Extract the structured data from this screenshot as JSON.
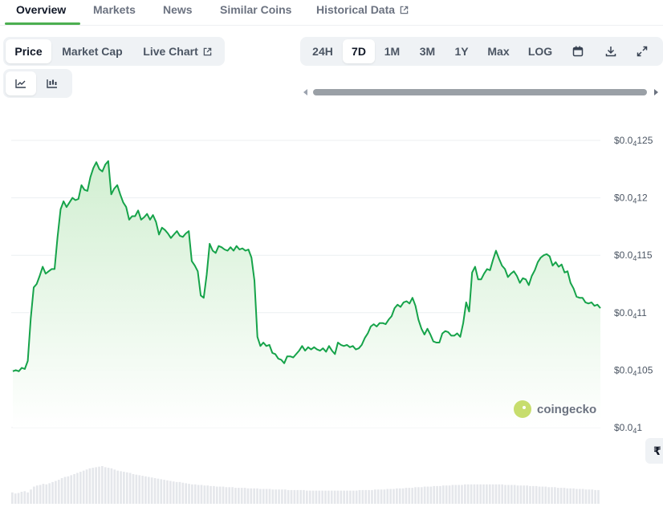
{
  "nav": {
    "tabs": [
      {
        "label": "Overview",
        "active": true
      },
      {
        "label": "Markets",
        "active": false
      },
      {
        "label": "News",
        "active": false
      },
      {
        "label": "Similar Coins",
        "active": false
      },
      {
        "label": "Historical Data",
        "active": false,
        "external": true
      }
    ]
  },
  "metric_toggle": {
    "options": [
      {
        "label": "Price",
        "active": true
      },
      {
        "label": "Market Cap",
        "active": false
      },
      {
        "label": "Live Chart",
        "active": false,
        "external": true
      }
    ]
  },
  "range_toggle": {
    "options": [
      {
        "label": "24H",
        "active": false
      },
      {
        "label": "7D",
        "active": true
      },
      {
        "label": "1M",
        "active": false
      },
      {
        "label": "3M",
        "active": false
      },
      {
        "label": "1Y",
        "active": false
      },
      {
        "label": "Max",
        "active": false
      },
      {
        "label": "LOG",
        "active": false
      }
    ],
    "icons": [
      "calendar-icon",
      "download-icon",
      "expand-icon"
    ]
  },
  "chart_type_toggle": {
    "options": [
      {
        "icon": "line-chart-icon",
        "active": true
      },
      {
        "icon": "candlestick-chart-icon",
        "active": false
      }
    ]
  },
  "watermark": {
    "text": "coingecko"
  },
  "side_button": {
    "glyph": "₹"
  },
  "colors": {
    "accent": "#4caf50",
    "line": "#16a34a",
    "area_top": "#cfeecf",
    "volume": "#e5e7eb"
  },
  "chart_data": {
    "type": "area",
    "title": "",
    "xlabel": "",
    "ylabel": "",
    "ylim": [
      1e-05,
      1.26e-05
    ],
    "y_ticks": [
      {
        "value": 1.25e-05,
        "label_prefix": "$0.0",
        "label_sub": "4",
        "label_suffix": "125"
      },
      {
        "value": 1.2e-05,
        "label_prefix": "$0.0",
        "label_sub": "4",
        "label_suffix": "12"
      },
      {
        "value": 1.15e-05,
        "label_prefix": "$0.0",
        "label_sub": "4",
        "label_suffix": "115"
      },
      {
        "value": 1.1e-05,
        "label_prefix": "$0.0",
        "label_sub": "4",
        "label_suffix": "11"
      },
      {
        "value": 1.05e-05,
        "label_prefix": "$0.0",
        "label_sub": "4",
        "label_suffix": "105"
      },
      {
        "value": 1e-05,
        "label_prefix": "$0.0",
        "label_sub": "4",
        "label_suffix": "1"
      }
    ],
    "grid": true,
    "series": [
      {
        "values": [
          10.49,
          10.5,
          10.49,
          10.52,
          10.51,
          10.58,
          10.95,
          11.22,
          11.25,
          11.32,
          11.4,
          11.34,
          11.36,
          11.38,
          11.38,
          11.66,
          11.9,
          11.97,
          11.92,
          11.96,
          12.0,
          11.98,
          11.99,
          12.11,
          12.07,
          12.06,
          12.18,
          12.26,
          12.31,
          12.25,
          12.23,
          12.29,
          12.32,
          12.03,
          12.08,
          12.11,
          12.03,
          11.96,
          11.92,
          11.81,
          11.84,
          11.84,
          11.89,
          11.81,
          11.83,
          11.86,
          11.81,
          11.85,
          11.79,
          11.68,
          11.74,
          11.72,
          11.69,
          11.65,
          11.68,
          11.71,
          11.67,
          11.66,
          11.69,
          11.71,
          11.45,
          11.41,
          11.36,
          11.15,
          11.13,
          11.33,
          11.6,
          11.54,
          11.52,
          11.58,
          11.57,
          11.55,
          11.54,
          11.57,
          11.54,
          11.58,
          11.55,
          11.56,
          11.54,
          11.55,
          11.48,
          11.28,
          10.79,
          10.71,
          10.74,
          10.71,
          10.72,
          10.65,
          10.64,
          10.6,
          10.59,
          10.56,
          10.62,
          10.62,
          10.61,
          10.64,
          10.67,
          10.71,
          10.67,
          10.7,
          10.68,
          10.7,
          10.68,
          10.67,
          10.69,
          10.66,
          10.71,
          10.67,
          10.64,
          10.74,
          10.72,
          10.71,
          10.72,
          10.7,
          10.71,
          10.68,
          10.69,
          10.72,
          10.78,
          10.82,
          10.88,
          10.9,
          10.88,
          10.91,
          10.91,
          10.9,
          10.94,
          10.97,
          11.04,
          11.07,
          11.05,
          11.09,
          11.1,
          11.08,
          11.13,
          11.06,
          10.94,
          10.86,
          10.81,
          10.86,
          10.81,
          10.75,
          10.74,
          10.74,
          10.82,
          10.84,
          10.83,
          10.8,
          10.8,
          10.82,
          10.79,
          10.91,
          11.09,
          11.01,
          11.35,
          11.4,
          11.29,
          11.29,
          11.34,
          11.38,
          11.37,
          11.46,
          11.54,
          11.47,
          11.41,
          11.38,
          11.31,
          11.34,
          11.36,
          11.32,
          11.26,
          11.3,
          11.29,
          11.24,
          11.32,
          11.37,
          11.44,
          11.48,
          11.5,
          11.51,
          11.49,
          11.41,
          11.44,
          11.4,
          11.42,
          11.35,
          11.36,
          11.26,
          11.21,
          11.14,
          11.13,
          11.13,
          11.09,
          11.08,
          11.09,
          11.06,
          11.07,
          11.04
        ]
      }
    ],
    "volume": [
      0.2,
      0.18,
      0.19,
      0.21,
      0.22,
      0.2,
      0.25,
      0.3,
      0.32,
      0.33,
      0.35,
      0.34,
      0.36,
      0.38,
      0.4,
      0.42,
      0.45,
      0.47,
      0.48,
      0.5,
      0.52,
      0.54,
      0.56,
      0.58,
      0.6,
      0.62,
      0.63,
      0.64,
      0.65,
      0.66,
      0.64,
      0.63,
      0.62,
      0.6,
      0.58,
      0.57,
      0.56,
      0.55,
      0.54,
      0.52,
      0.51,
      0.5,
      0.49,
      0.48,
      0.47,
      0.46,
      0.45,
      0.44,
      0.43,
      0.42,
      0.41,
      0.4,
      0.39,
      0.38,
      0.38,
      0.37,
      0.36,
      0.35,
      0.34,
      0.34,
      0.33,
      0.33,
      0.32,
      0.32,
      0.31,
      0.31,
      0.3,
      0.3,
      0.3,
      0.29,
      0.29,
      0.29,
      0.28,
      0.28,
      0.28,
      0.28,
      0.27,
      0.27,
      0.27,
      0.27,
      0.26,
      0.26,
      0.26,
      0.26,
      0.25,
      0.25,
      0.25,
      0.25,
      0.25,
      0.24,
      0.24,
      0.24,
      0.24,
      0.24,
      0.24,
      0.23,
      0.23,
      0.23,
      0.23,
      0.23,
      0.23,
      0.23,
      0.23,
      0.23,
      0.23,
      0.23,
      0.23,
      0.23,
      0.23,
      0.23,
      0.23,
      0.23,
      0.24,
      0.24,
      0.24,
      0.24,
      0.24,
      0.25,
      0.25,
      0.25,
      0.25,
      0.26,
      0.26,
      0.26,
      0.27,
      0.27,
      0.27,
      0.28,
      0.28,
      0.28,
      0.29,
      0.29,
      0.29,
      0.3,
      0.3,
      0.3,
      0.31,
      0.31,
      0.31,
      0.32,
      0.32,
      0.32,
      0.33,
      0.33,
      0.33,
      0.33,
      0.34,
      0.34,
      0.34,
      0.34,
      0.34,
      0.34,
      0.34,
      0.34,
      0.34,
      0.34,
      0.34,
      0.34,
      0.34,
      0.33,
      0.33,
      0.33,
      0.33,
      0.32,
      0.32,
      0.32,
      0.32,
      0.31,
      0.31,
      0.31,
      0.3,
      0.3,
      0.3,
      0.29,
      0.29,
      0.29,
      0.28,
      0.28,
      0.28,
      0.27,
      0.27,
      0.27,
      0.26,
      0.26,
      0.26,
      0.25,
      0.25,
      0.25,
      0.24,
      0.24
    ]
  }
}
